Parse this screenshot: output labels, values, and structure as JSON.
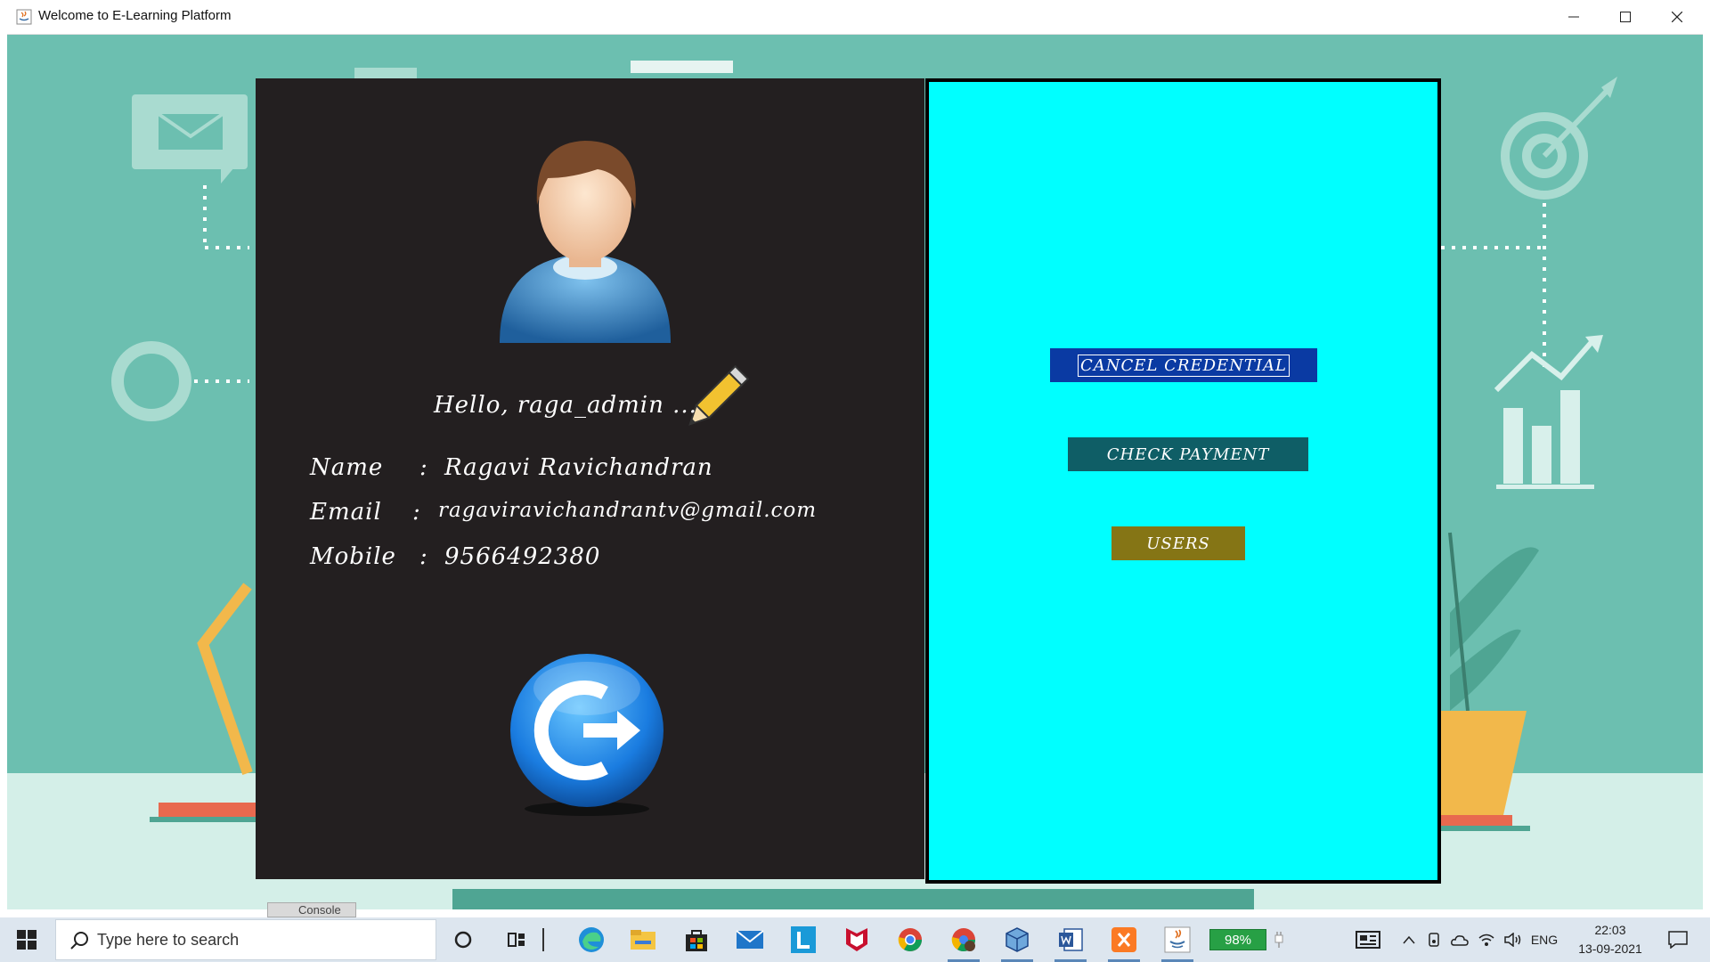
{
  "window": {
    "title": "Welcome to E-Learning Platform"
  },
  "profile": {
    "greeting": "Hello, raga_admin ...",
    "name_label": "Name",
    "email_label": "Email",
    "mobile_label": "Mobile",
    "colon": ":",
    "name_value": "Ragavi Ravichandran",
    "email_value": "ragaviravichandrantv@gmail.com",
    "mobile_value": "9566492380"
  },
  "admin_actions": {
    "cancel_credential": "CANCEL CREDENTIAL",
    "check_payment": "CHECK PAYMENT",
    "users": "USERS"
  },
  "taskbar": {
    "search_placeholder": "Type here to search",
    "battery": "98%",
    "language": "ENG",
    "time": "22:03",
    "date": "13-09-2021",
    "hidden_window_label": "Console"
  },
  "colors": {
    "background_teal": "#6cbfb0",
    "profile_panel": "#231f20",
    "admin_panel": "#00ffff",
    "cancel_button": "#0a3aa3",
    "payment_button": "#0f5e66",
    "users_button": "#857515"
  }
}
